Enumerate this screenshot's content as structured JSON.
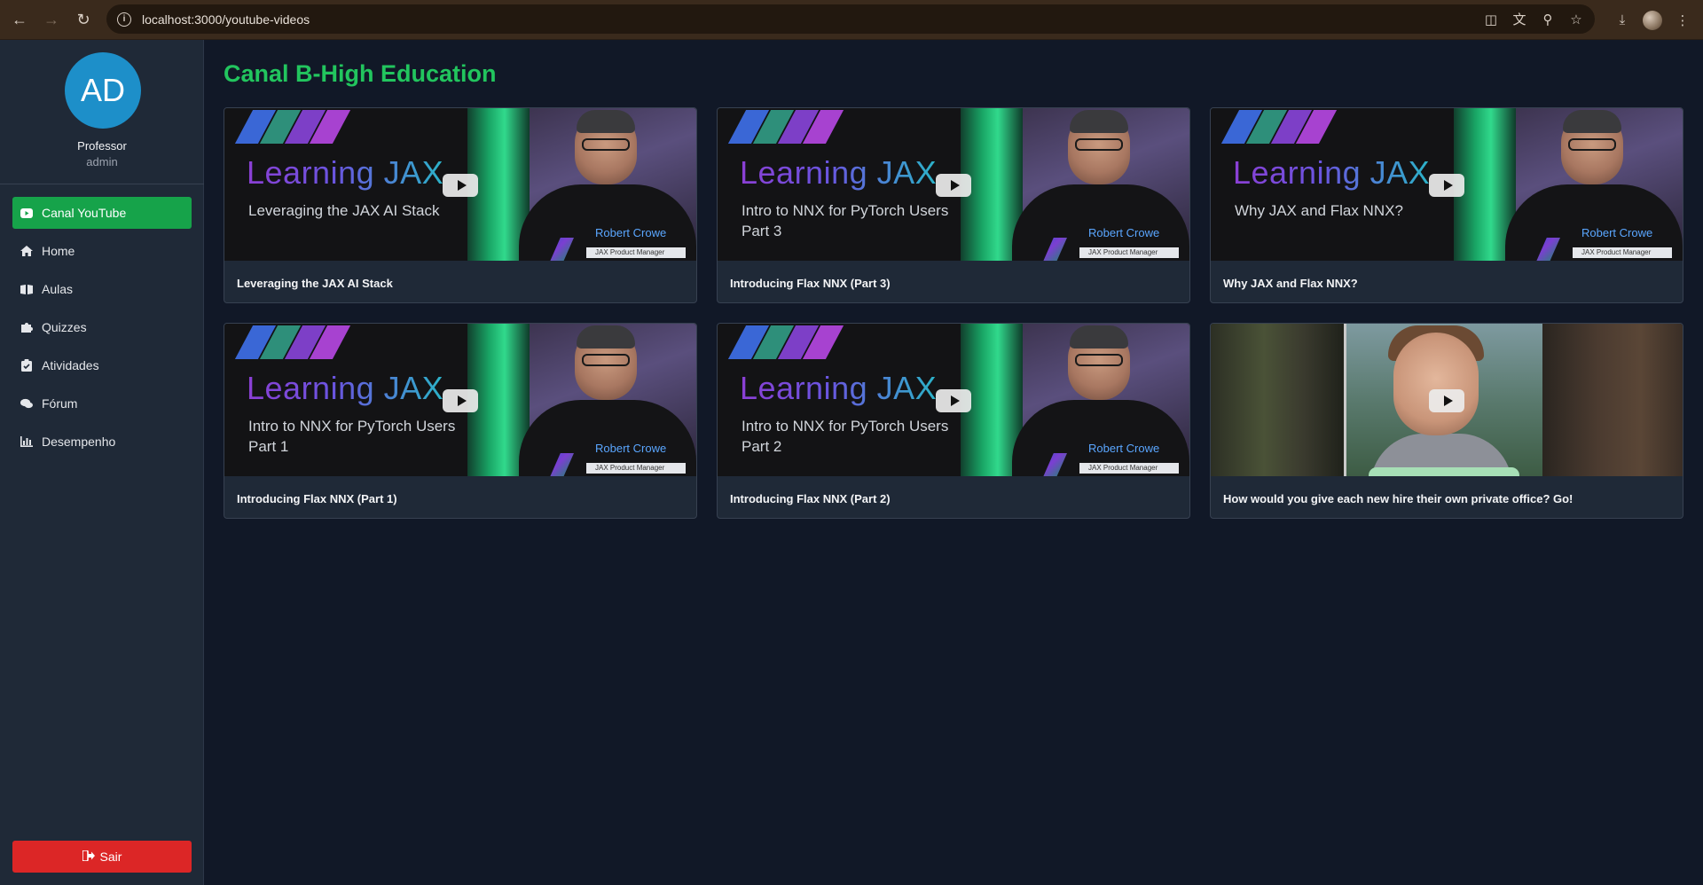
{
  "browser": {
    "url": "localhost:3000/youtube-videos"
  },
  "sidebar": {
    "avatar_initials": "AD",
    "user_name": "Professor",
    "user_role": "admin",
    "items": [
      {
        "label": "Canal YouTube",
        "icon": "youtube-icon",
        "active": true
      },
      {
        "label": "Home",
        "icon": "home-icon",
        "active": false
      },
      {
        "label": "Aulas",
        "icon": "book-icon",
        "active": false
      },
      {
        "label": "Quizzes",
        "icon": "puzzle-icon",
        "active": false
      },
      {
        "label": "Atividades",
        "icon": "clipboard-icon",
        "active": false
      },
      {
        "label": "Fórum",
        "icon": "comments-icon",
        "active": false
      },
      {
        "label": "Desempenho",
        "icon": "chart-icon",
        "active": false
      }
    ],
    "logout_label": "Sair"
  },
  "main": {
    "title": "Canal B-High Education",
    "videos": [
      {
        "title": "Leveraging the JAX AI Stack",
        "thumb": {
          "heading": "Learning JAX",
          "sub1": "Leveraging the JAX AI Stack",
          "sub2": "",
          "presenter": "Robert Crowe",
          "presenter_role": "JAX Product Manager"
        }
      },
      {
        "title": "Introducing Flax NNX (Part 3)",
        "thumb": {
          "heading": "Learning JAX",
          "sub1": "Intro to NNX for PyTorch Users",
          "sub2": "Part 3",
          "presenter": "Robert Crowe",
          "presenter_role": "JAX Product Manager"
        }
      },
      {
        "title": "Why JAX and Flax NNX?",
        "thumb": {
          "heading": "Learning JAX",
          "sub1": "Why JAX and Flax NNX?",
          "sub2": "",
          "presenter": "Robert Crowe",
          "presenter_role": "JAX Product Manager"
        }
      },
      {
        "title": "Introducing Flax NNX (Part 1)",
        "thumb": {
          "heading": "Learning JAX",
          "sub1": "Intro to NNX for PyTorch Users",
          "sub2": "Part 1",
          "presenter": "Robert Crowe",
          "presenter_role": "JAX Product Manager"
        }
      },
      {
        "title": "Introducing Flax NNX (Part 2)",
        "thumb": {
          "heading": "Learning JAX",
          "sub1": "Intro to NNX for PyTorch Users",
          "sub2": "Part 2",
          "presenter": "Robert Crowe",
          "presenter_role": "JAX Product Manager"
        }
      },
      {
        "title": "How would you give each new hire their own private office? Go!"
      }
    ]
  },
  "colors": {
    "accent_green": "#22c55e",
    "active_nav": "#16a34a",
    "logout_red": "#dc2626",
    "avatar_blue": "#1d8fc9",
    "background": "#111827",
    "sidebar_bg": "#1f2937"
  }
}
